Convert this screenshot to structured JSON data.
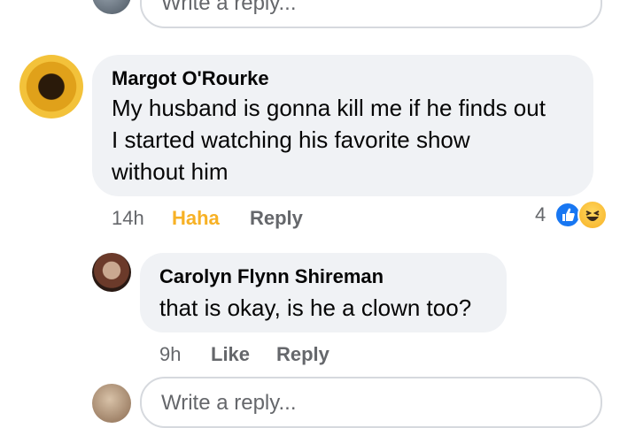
{
  "top_reply": {
    "placeholder": "Write a reply..."
  },
  "comment1": {
    "author": "Margot O'Rourke",
    "text_line1": "My husband is gonna kill me if he finds out",
    "text_line2": "I started watching his favorite show",
    "text_line3": "without him",
    "time": "14h",
    "reaction_label": "Haha",
    "reply_label": "Reply",
    "reaction_count": "4",
    "reaction_icons": [
      "like-icon",
      "haha-icon"
    ]
  },
  "comment2": {
    "author": "Carolyn Flynn Shireman",
    "text": "that is okay, is he a clown too?",
    "time": "9h",
    "like_label": "Like",
    "reply_label": "Reply"
  },
  "bottom_reply": {
    "placeholder": "Write a reply..."
  },
  "colors": {
    "bubble": "#f0f2f5",
    "haha": "#f7b125",
    "like_blue": "#1877f2",
    "secondary_text": "#65676b"
  }
}
